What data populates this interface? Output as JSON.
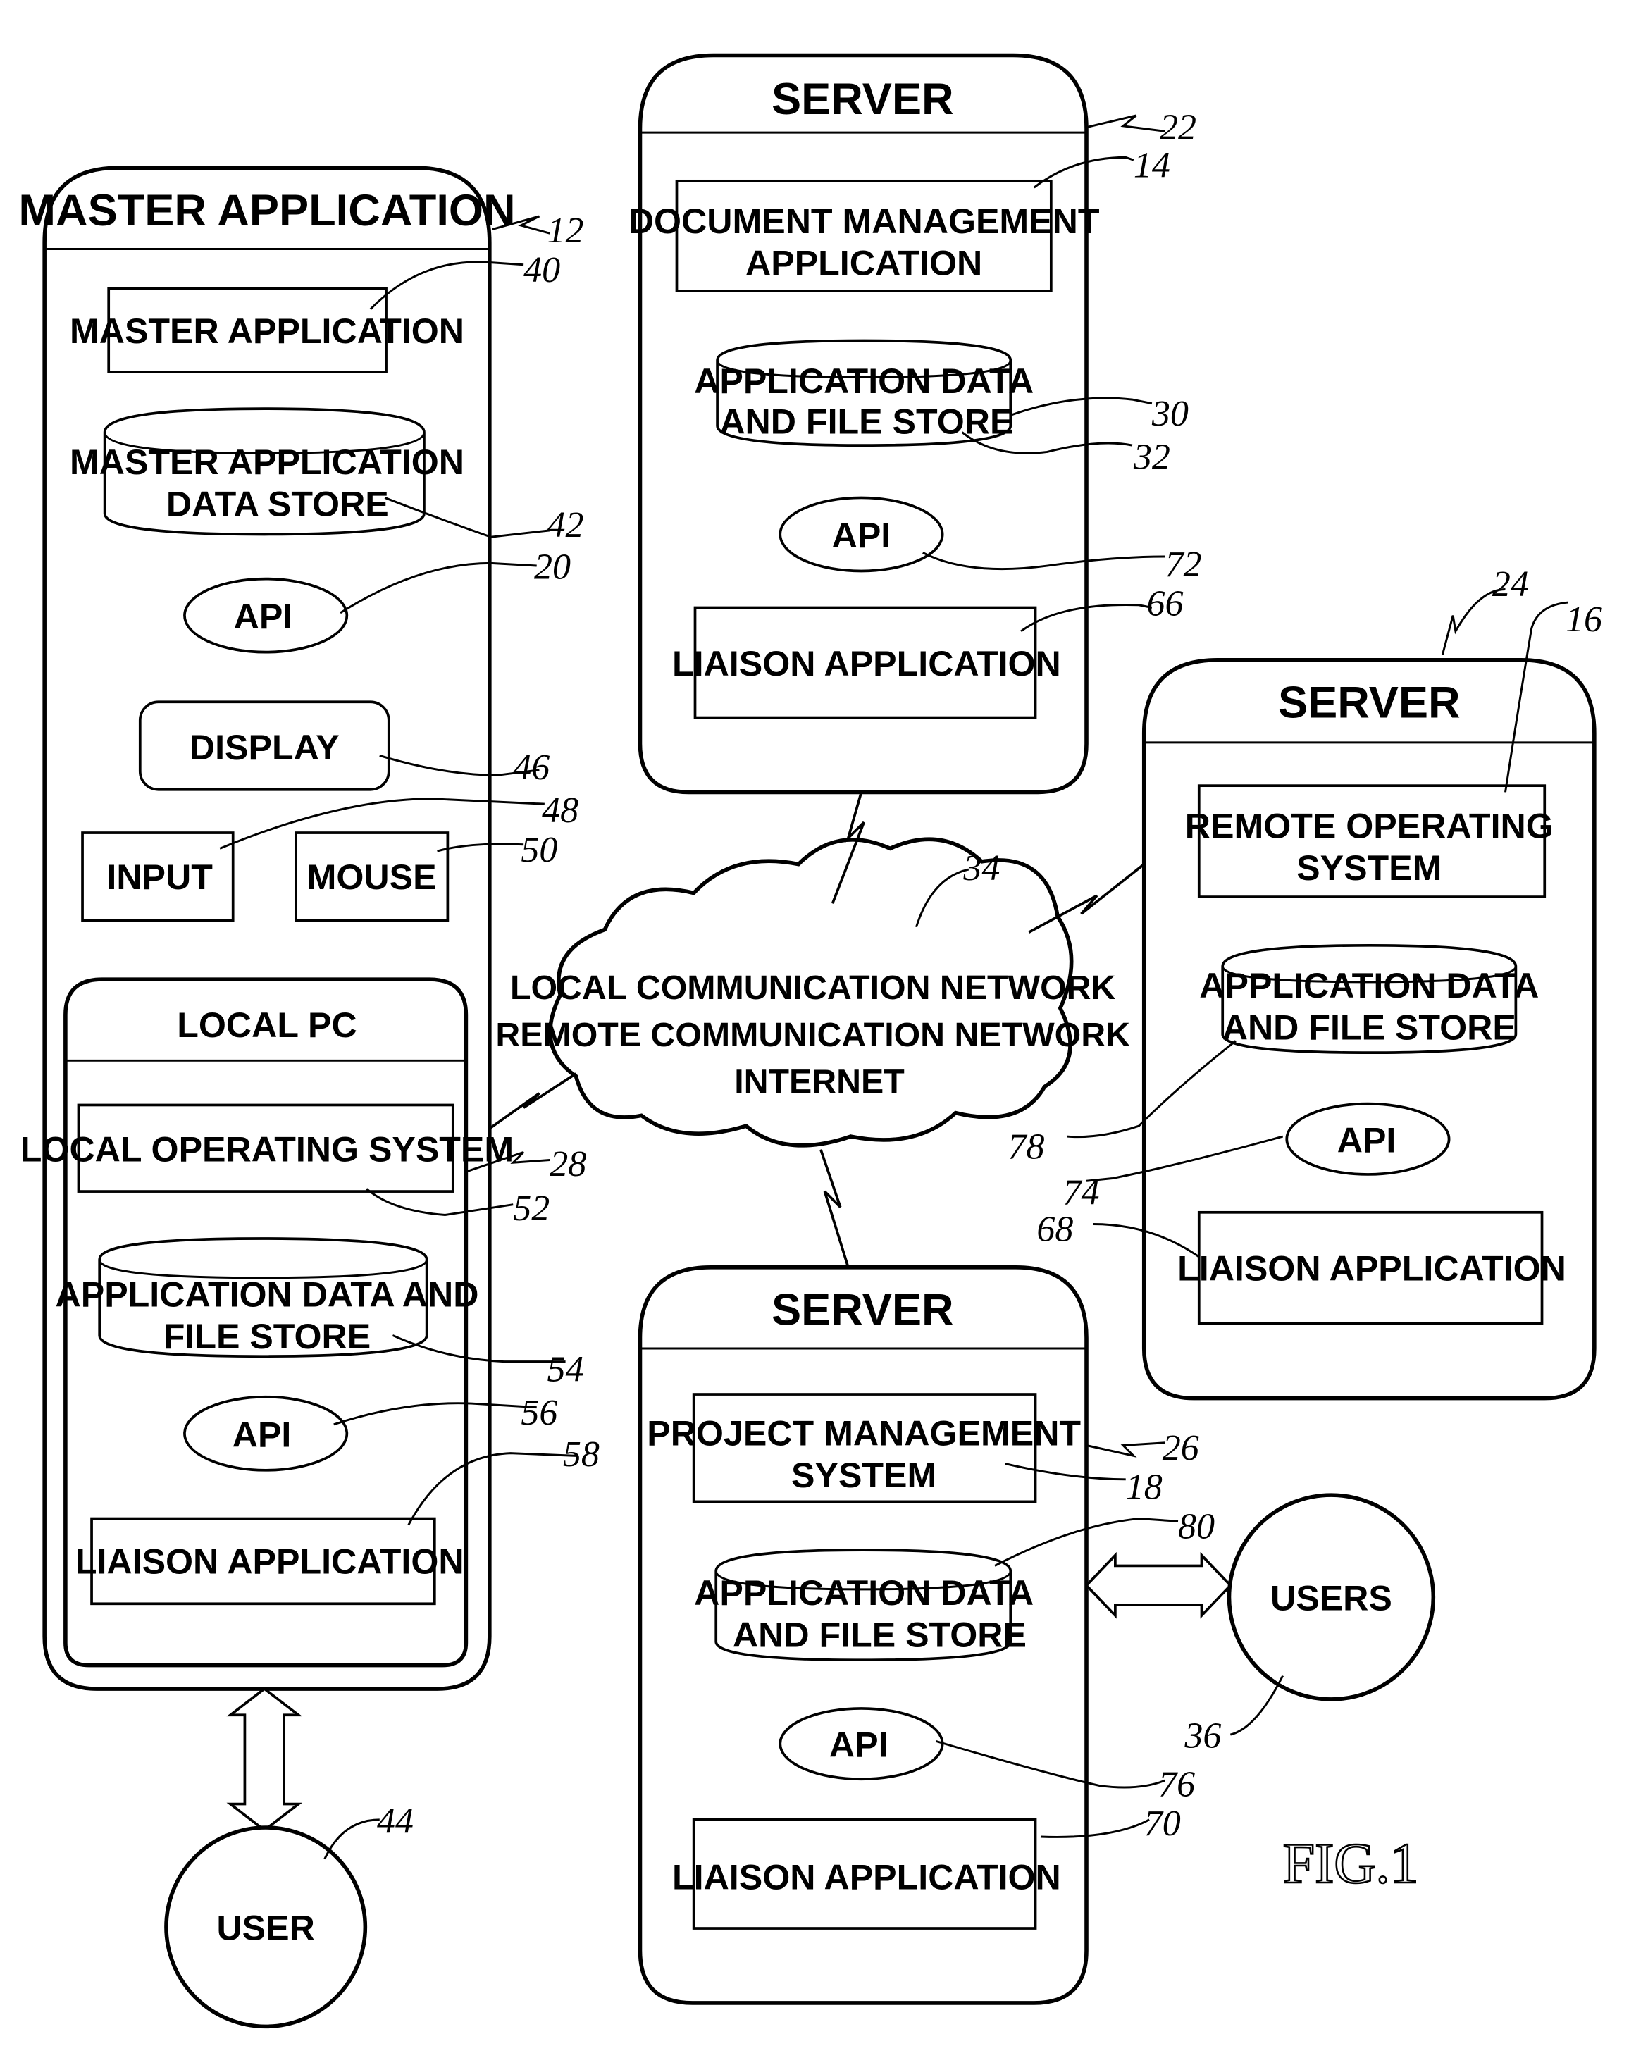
{
  "figure_label": "FIG.1",
  "master": {
    "title": "MASTER APPLICATION",
    "ref": "12",
    "app": {
      "label": "MASTER APPLICATION",
      "ref": "40"
    },
    "store": {
      "line1": "MASTER APPLICATION",
      "line2": "DATA STORE",
      "ref": "42"
    },
    "api": {
      "label": "API",
      "ref": "20"
    },
    "display": {
      "label": "DISPLAY",
      "ref": "46"
    },
    "input": {
      "label": "INPUT",
      "ref": "48"
    },
    "mouse": {
      "label": "MOUSE",
      "ref": "50"
    },
    "local_pc": {
      "title": "LOCAL PC",
      "ref": "28",
      "os": {
        "label": "LOCAL OPERATING SYSTEM",
        "ref": "52"
      },
      "store": {
        "line1": "APPLICATION DATA AND",
        "line2": "FILE STORE",
        "ref": "54"
      },
      "api": {
        "label": "API",
        "ref": "56"
      },
      "liaison": {
        "label": "LIAISON APPLICATION",
        "ref": "58"
      }
    }
  },
  "user": {
    "label": "USER",
    "ref": "44"
  },
  "server_doc": {
    "title": "SERVER",
    "ref": "22",
    "app": {
      "line1": "DOCUMENT MANAGEMENT",
      "line2": "APPLICATION",
      "ref": "14"
    },
    "store": {
      "line1": "APPLICATION DATA",
      "line2": "AND FILE STORE",
      "ref1": "30",
      "ref2": "32"
    },
    "api": {
      "label": "API",
      "ref": "72"
    },
    "liaison": {
      "label": "LIAISON APPLICATION",
      "ref": "66"
    }
  },
  "server_remote": {
    "title": "SERVER",
    "ref": "24",
    "os": {
      "line1": "REMOTE OPERATING",
      "line2": "SYSTEM",
      "ref": "16"
    },
    "store": {
      "line1": "APPLICATION DATA",
      "line2": "AND FILE STORE",
      "ref": "78"
    },
    "api": {
      "label": "API",
      "ref": "74"
    },
    "liaison": {
      "label": "LIAISON APPLICATION",
      "ref": "68"
    }
  },
  "server_project": {
    "title": "SERVER",
    "ref": "26",
    "app": {
      "line1": "PROJECT MANAGEMENT",
      "line2": "SYSTEM",
      "ref": "18"
    },
    "store": {
      "line1": "APPLICATION DATA",
      "line2": "AND FILE STORE",
      "ref": "80"
    },
    "api": {
      "label": "API",
      "ref": "76"
    },
    "liaison": {
      "label": "LIAISON APPLICATION",
      "ref": "70"
    }
  },
  "network": {
    "line1": "LOCAL COMMUNICATION NETWORK",
    "line2": "REMOTE COMMUNICATION NETWORK",
    "line3": "INTERNET",
    "ref": "34"
  },
  "users": {
    "label": "USERS",
    "ref": "36"
  }
}
